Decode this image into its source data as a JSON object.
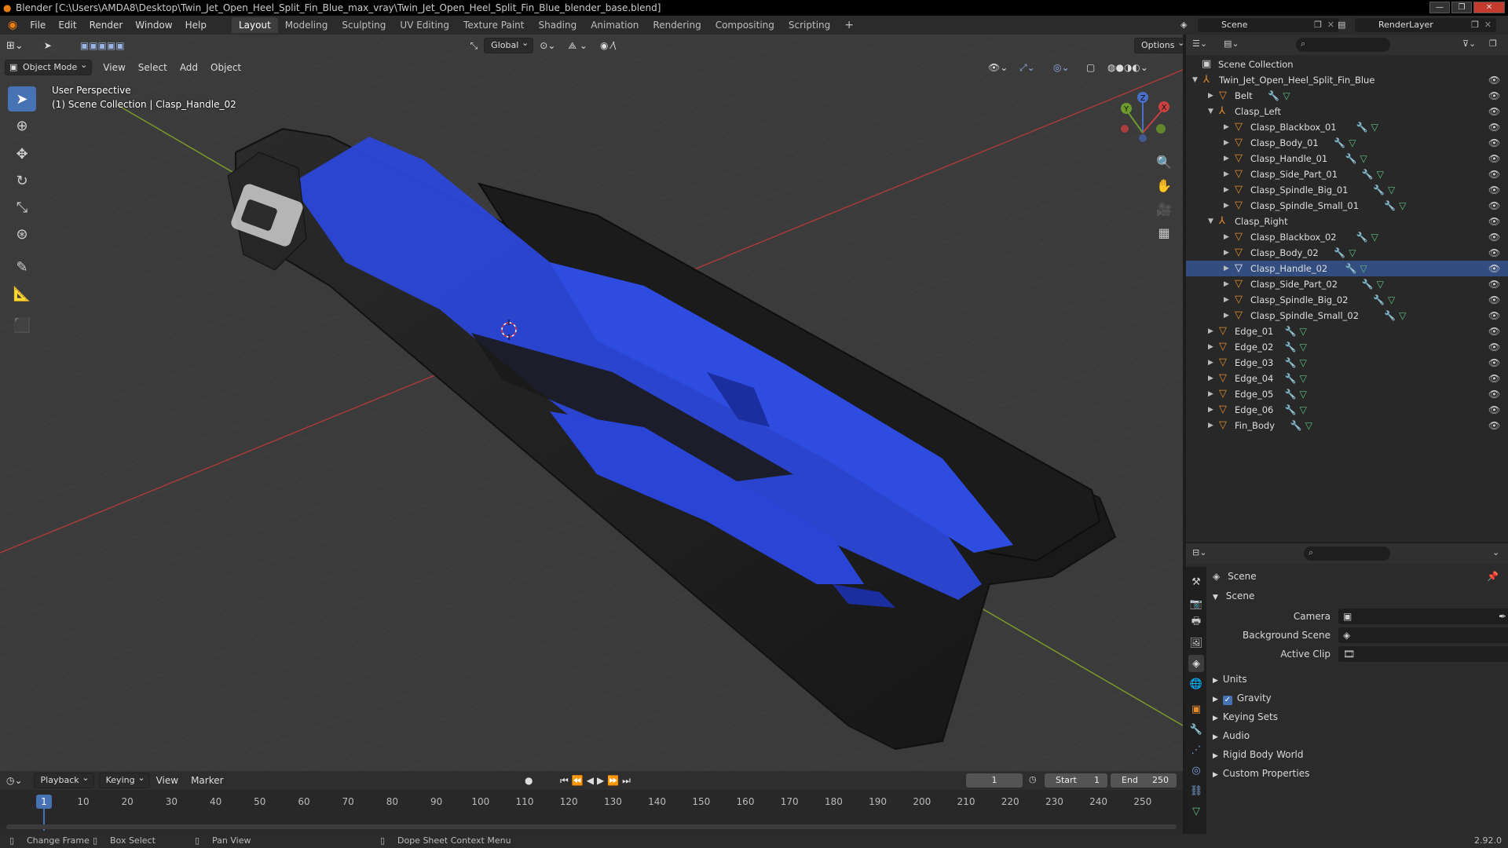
{
  "title": "Blender [C:\\Users\\AMDA8\\Desktop\\Twin_Jet_Open_Heel_Split_Fin_Blue_max_vray\\Twin_Jet_Open_Heel_Split_Fin_Blue_blender_base.blend]",
  "menu": [
    "File",
    "Edit",
    "Render",
    "Window",
    "Help"
  ],
  "workspaces": [
    "Layout",
    "Modeling",
    "Sculpting",
    "UV Editing",
    "Texture Paint",
    "Shading",
    "Animation",
    "Rendering",
    "Compositing",
    "Scripting"
  ],
  "scene_name": "Scene",
  "render_layer": "RenderLayer",
  "viewport": {
    "orientation": "Global",
    "options": "Options",
    "mode": "Object Mode",
    "menus": [
      "View",
      "Select",
      "Add",
      "Object"
    ],
    "perspective": "User Perspective",
    "collection_info": "(1) Scene Collection | Clasp_Handle_02",
    "gizmo": {
      "x": "X",
      "y": "Y",
      "z": "Z"
    }
  },
  "outliner": {
    "root": "Scene Collection",
    "rows": [
      {
        "name": "Twin_Jet_Open_Heel_Split_Fin_Blue",
        "depth": 0,
        "type": "empty",
        "expanded": true
      },
      {
        "name": "Belt",
        "depth": 1,
        "type": "mesh"
      },
      {
        "name": "Clasp_Left",
        "depth": 1,
        "type": "empty",
        "expanded": true
      },
      {
        "name": "Clasp_Blackbox_01",
        "depth": 2,
        "type": "mesh"
      },
      {
        "name": "Clasp_Body_01",
        "depth": 2,
        "type": "mesh"
      },
      {
        "name": "Clasp_Handle_01",
        "depth": 2,
        "type": "mesh"
      },
      {
        "name": "Clasp_Side_Part_01",
        "depth": 2,
        "type": "mesh"
      },
      {
        "name": "Clasp_Spindle_Big_01",
        "depth": 2,
        "type": "mesh"
      },
      {
        "name": "Clasp_Spindle_Small_01",
        "depth": 2,
        "type": "mesh"
      },
      {
        "name": "Clasp_Right",
        "depth": 1,
        "type": "empty",
        "expanded": true
      },
      {
        "name": "Clasp_Blackbox_02",
        "depth": 2,
        "type": "mesh"
      },
      {
        "name": "Clasp_Body_02",
        "depth": 2,
        "type": "mesh"
      },
      {
        "name": "Clasp_Handle_02",
        "depth": 2,
        "type": "mesh",
        "selected": true
      },
      {
        "name": "Clasp_Side_Part_02",
        "depth": 2,
        "type": "mesh"
      },
      {
        "name": "Clasp_Spindle_Big_02",
        "depth": 2,
        "type": "mesh"
      },
      {
        "name": "Clasp_Spindle_Small_02",
        "depth": 2,
        "type": "mesh"
      },
      {
        "name": "Edge_01",
        "depth": 1,
        "type": "mesh"
      },
      {
        "name": "Edge_02",
        "depth": 1,
        "type": "mesh"
      },
      {
        "name": "Edge_03",
        "depth": 1,
        "type": "mesh"
      },
      {
        "name": "Edge_04",
        "depth": 1,
        "type": "mesh"
      },
      {
        "name": "Edge_05",
        "depth": 1,
        "type": "mesh"
      },
      {
        "name": "Edge_06",
        "depth": 1,
        "type": "mesh"
      },
      {
        "name": "Fin_Body",
        "depth": 1,
        "type": "mesh"
      }
    ]
  },
  "properties": {
    "context": "Scene",
    "panel": "Scene",
    "fields": {
      "camera": "Camera",
      "background_scene": "Background Scene",
      "active_clip": "Active Clip"
    },
    "sections": [
      "Units",
      "Gravity",
      "Keying Sets",
      "Audio",
      "Rigid Body World",
      "Custom Properties"
    ],
    "gravity_checked": true
  },
  "timeline": {
    "menus": [
      "Playback",
      "Keying",
      "View",
      "Marker"
    ],
    "current_frame": "1",
    "start_label": "Start",
    "start": "1",
    "end_label": "End",
    "end": "250",
    "ticks": [
      "10",
      "20",
      "30",
      "40",
      "50",
      "60",
      "70",
      "80",
      "90",
      "100",
      "110",
      "120",
      "130",
      "140",
      "150",
      "160",
      "170",
      "180",
      "190",
      "200",
      "210",
      "220",
      "230",
      "240",
      "250"
    ]
  },
  "status": {
    "change_frame": "Change Frame",
    "box_select": "Box Select",
    "pan_view": "Pan View",
    "context_menu": "Dope Sheet Context Menu",
    "version": "2.92.0"
  },
  "colors": {
    "accent": "#4772b3",
    "fin_blue": "#2a46d8",
    "object_orange": "#e38b2c",
    "selected_row": "#334d80"
  }
}
